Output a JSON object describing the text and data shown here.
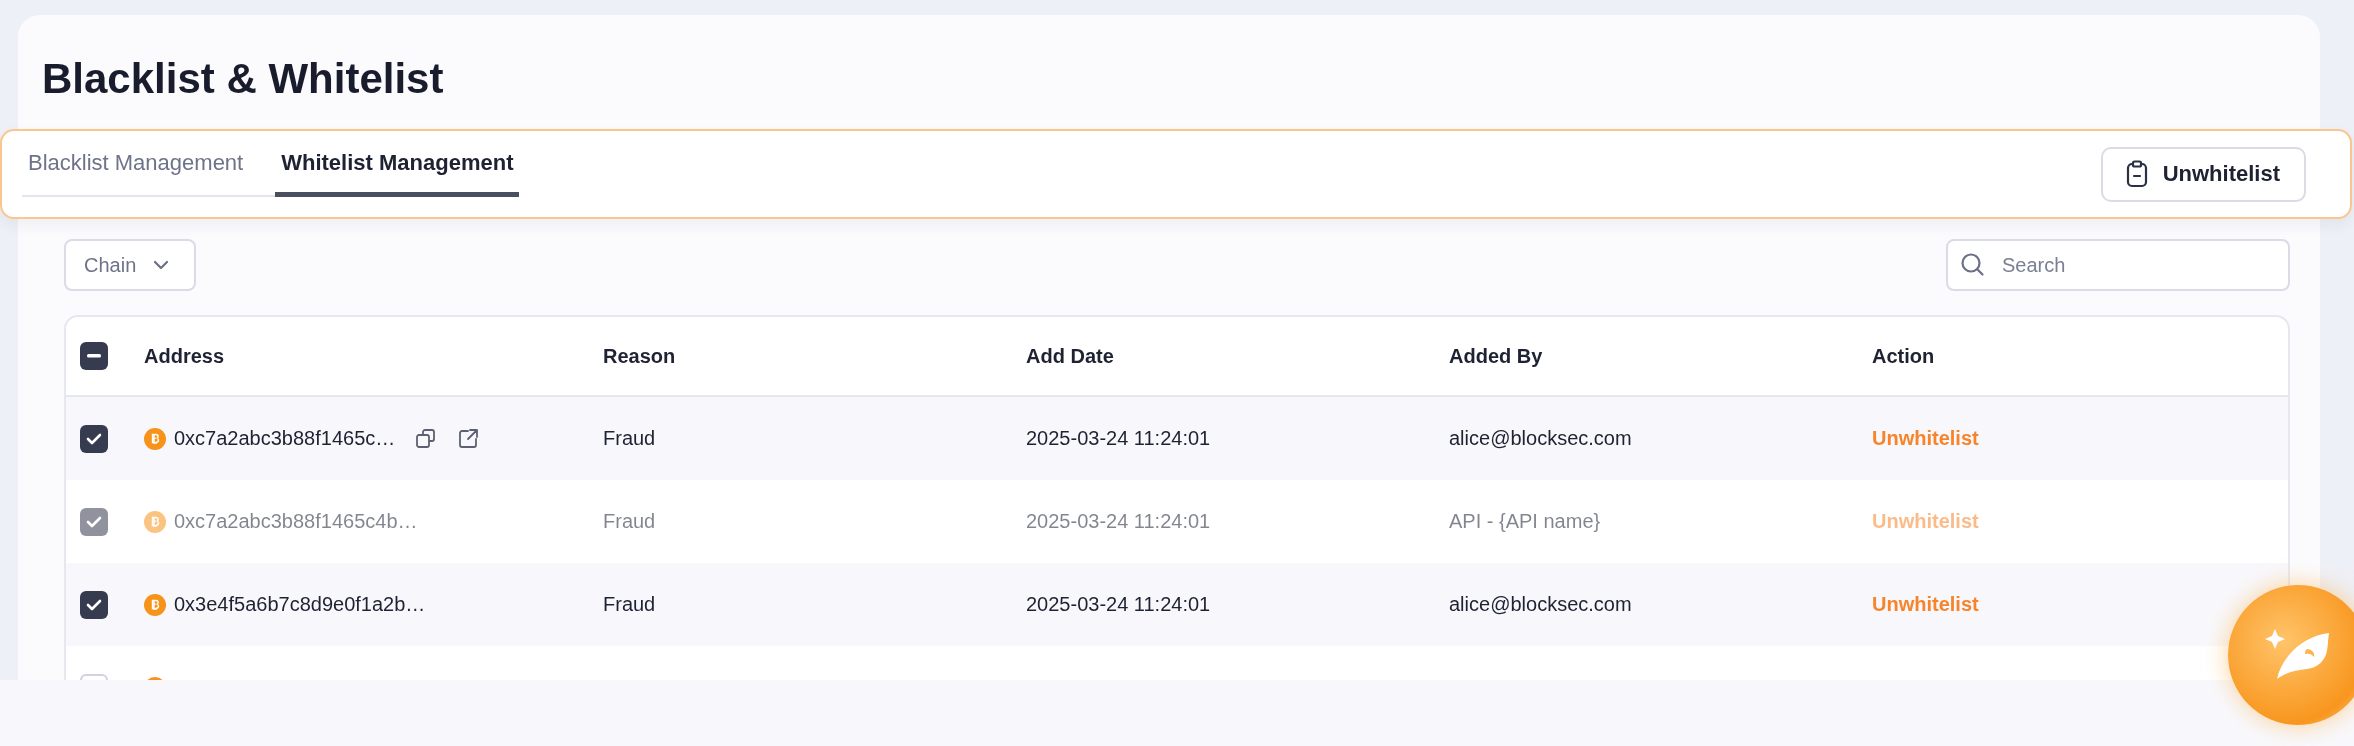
{
  "page": {
    "title": "Blacklist & Whitelist"
  },
  "tabs": [
    {
      "label": "Blacklist Management",
      "selected": false
    },
    {
      "label": "Whitelist Management",
      "selected": true
    }
  ],
  "toolbar_button": {
    "label": "Unwhitelist"
  },
  "chain_filter": {
    "label": "Chain"
  },
  "search": {
    "placeholder": "Search"
  },
  "table": {
    "select_all": {
      "checked": true,
      "indeterminate": true
    },
    "columns": [
      "Address",
      "Reason",
      "Add Date",
      "Added By",
      "Action"
    ],
    "rows": [
      {
        "checked": true,
        "disabled": false,
        "hovered": true,
        "address": "0xc7a2abc3b88f1465c…",
        "reason": "Fraud",
        "add_date": "2025-03-24 11:24:01",
        "added_by": "alice@blocksec.com",
        "action": "Unwhitelist"
      },
      {
        "checked": true,
        "disabled": true,
        "hovered": false,
        "address": "0xc7a2abc3b88f1465c4b…",
        "reason": "Fraud",
        "add_date": "2025-03-24 11:24:01",
        "added_by": "API - {API name}",
        "action": "Unwhitelist"
      },
      {
        "checked": true,
        "disabled": false,
        "hovered": false,
        "address": "0x3e4f5a6b7c8d9e0f1a2b…",
        "reason": "Fraud",
        "add_date": "2025-03-24 11:24:01",
        "added_by": "alice@blocksec.com",
        "action": "Unwhitelist"
      },
      {
        "checked": false,
        "disabled": false,
        "hovered": false
      }
    ]
  }
}
